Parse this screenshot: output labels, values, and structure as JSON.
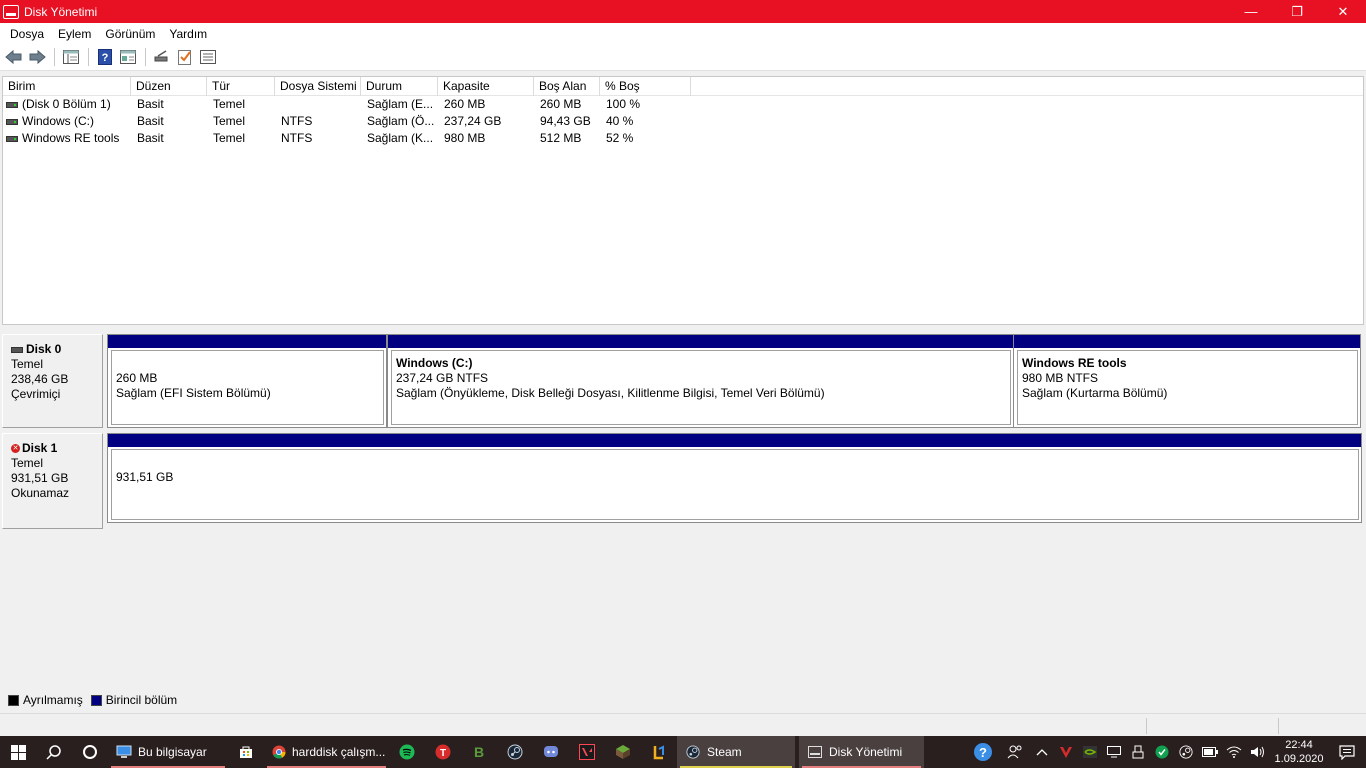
{
  "window": {
    "title": "Disk Yönetimi",
    "minimize": "—",
    "restore": "❐",
    "close": "✕"
  },
  "menu": [
    "Dosya",
    "Eylem",
    "Görünüm",
    "Yardım"
  ],
  "columns": [
    "Birim",
    "Düzen",
    "Tür",
    "Dosya Sistemi",
    "Durum",
    "Kapasite",
    "Boş Alan",
    "% Boş"
  ],
  "volumes": [
    {
      "name": "(Disk 0 Bölüm 1)",
      "layout": "Basit",
      "type": "Temel",
      "fs": "",
      "status": "Sağlam (E...",
      "capacity": "260 MB",
      "free": "260 MB",
      "pct": "100 %"
    },
    {
      "name": "Windows (C:)",
      "layout": "Basit",
      "type": "Temel",
      "fs": "NTFS",
      "status": "Sağlam (Ö...",
      "capacity": "237,24 GB",
      "free": "94,43 GB",
      "pct": "40 %"
    },
    {
      "name": "Windows RE tools",
      "layout": "Basit",
      "type": "Temel",
      "fs": "NTFS",
      "status": "Sağlam (K...",
      "capacity": "980 MB",
      "free": "512 MB",
      "pct": "52 %"
    }
  ],
  "disks": [
    {
      "name": "Disk 0",
      "type": "Temel",
      "size": "238,46 GB",
      "state": "Çevrimiçi",
      "partitions": [
        {
          "title": "",
          "size": "260 MB",
          "status": "Sağlam (EFI Sistem Bölümü)"
        },
        {
          "title": "Windows  (C:)",
          "size": "237,24 GB NTFS",
          "status": "Sağlam (Önyükleme, Disk Belleği Dosyası, Kilitlenme Bilgisi, Temel Veri Bölümü)"
        },
        {
          "title": "Windows RE tools",
          "size": "980 MB NTFS",
          "status": "Sağlam (Kurtarma Bölümü)"
        }
      ]
    },
    {
      "name": "Disk 1",
      "type": "Temel",
      "size": "931,51 GB",
      "state": "Okunamaz",
      "partitions": [
        {
          "title": "",
          "size": "931,51 GB",
          "status": ""
        }
      ]
    }
  ],
  "legend": [
    {
      "label": "Ayrılmamış",
      "color": "#000000"
    },
    {
      "label": "Birincil bölüm",
      "color": "#000080"
    }
  ],
  "taskbar": {
    "tasks": [
      {
        "label": "Bu bilgisayar",
        "icon": "computer-icon"
      },
      {
        "label": "harddisk çalışm...",
        "icon": "chrome-icon"
      },
      {
        "label": "Steam",
        "icon": "steam-icon"
      },
      {
        "label": "Disk Yönetimi",
        "icon": "disk-management-icon"
      }
    ],
    "time": "22:44",
    "date": "1.09.2020"
  },
  "colors": {
    "titlebar": "#e81123",
    "primary_partition": "#000080",
    "taskbar": "#2a1f1f"
  }
}
